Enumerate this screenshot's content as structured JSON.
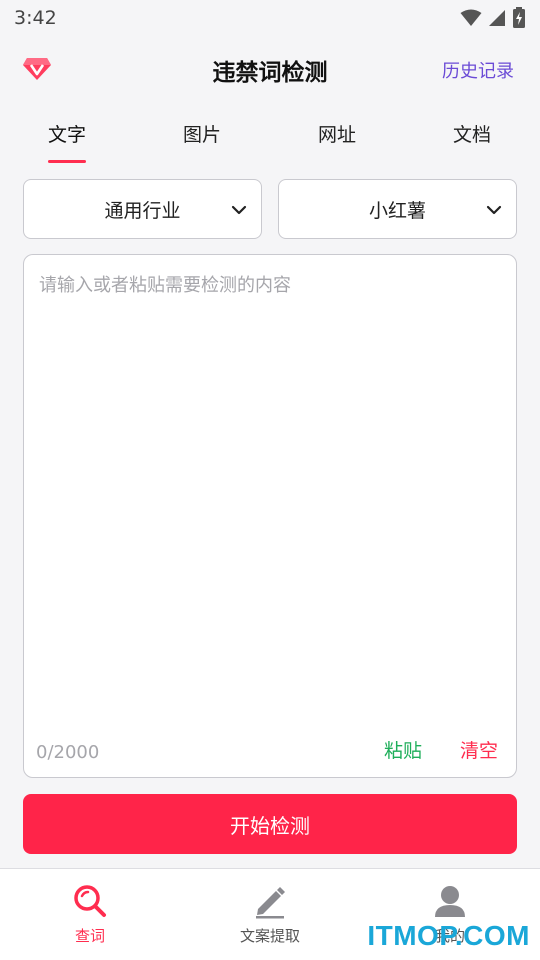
{
  "status_bar": {
    "time": "3:42",
    "icons": [
      "wifi-icon",
      "signal-icon",
      "battery-charging-icon"
    ]
  },
  "header": {
    "title": "违禁词检测",
    "history_label": "历史记录",
    "vip_icon": "vip-diamond-icon"
  },
  "tabs": [
    {
      "label": "文字",
      "active": true
    },
    {
      "label": "图片",
      "active": false
    },
    {
      "label": "网址",
      "active": false
    },
    {
      "label": "文档",
      "active": false
    }
  ],
  "filters": {
    "industry": "通用行业",
    "platform": "小红薯"
  },
  "input": {
    "placeholder": "请输入或者粘贴需要检测的内容",
    "counter": "0/2000",
    "paste_label": "粘贴",
    "clear_label": "清空"
  },
  "start_button": "开始检测",
  "bottom_nav": [
    {
      "label": "查词",
      "icon": "search-icon",
      "active": true
    },
    {
      "label": "文案提取",
      "icon": "edit-icon",
      "active": false
    },
    {
      "label": "我的",
      "icon": "user-icon",
      "active": false
    }
  ],
  "watermark": "ITMOP.COM",
  "colors": {
    "accent": "#ff2449",
    "history_link": "#6b4bd6",
    "paste": "#1fae5a",
    "background": "#f5f5f7"
  }
}
